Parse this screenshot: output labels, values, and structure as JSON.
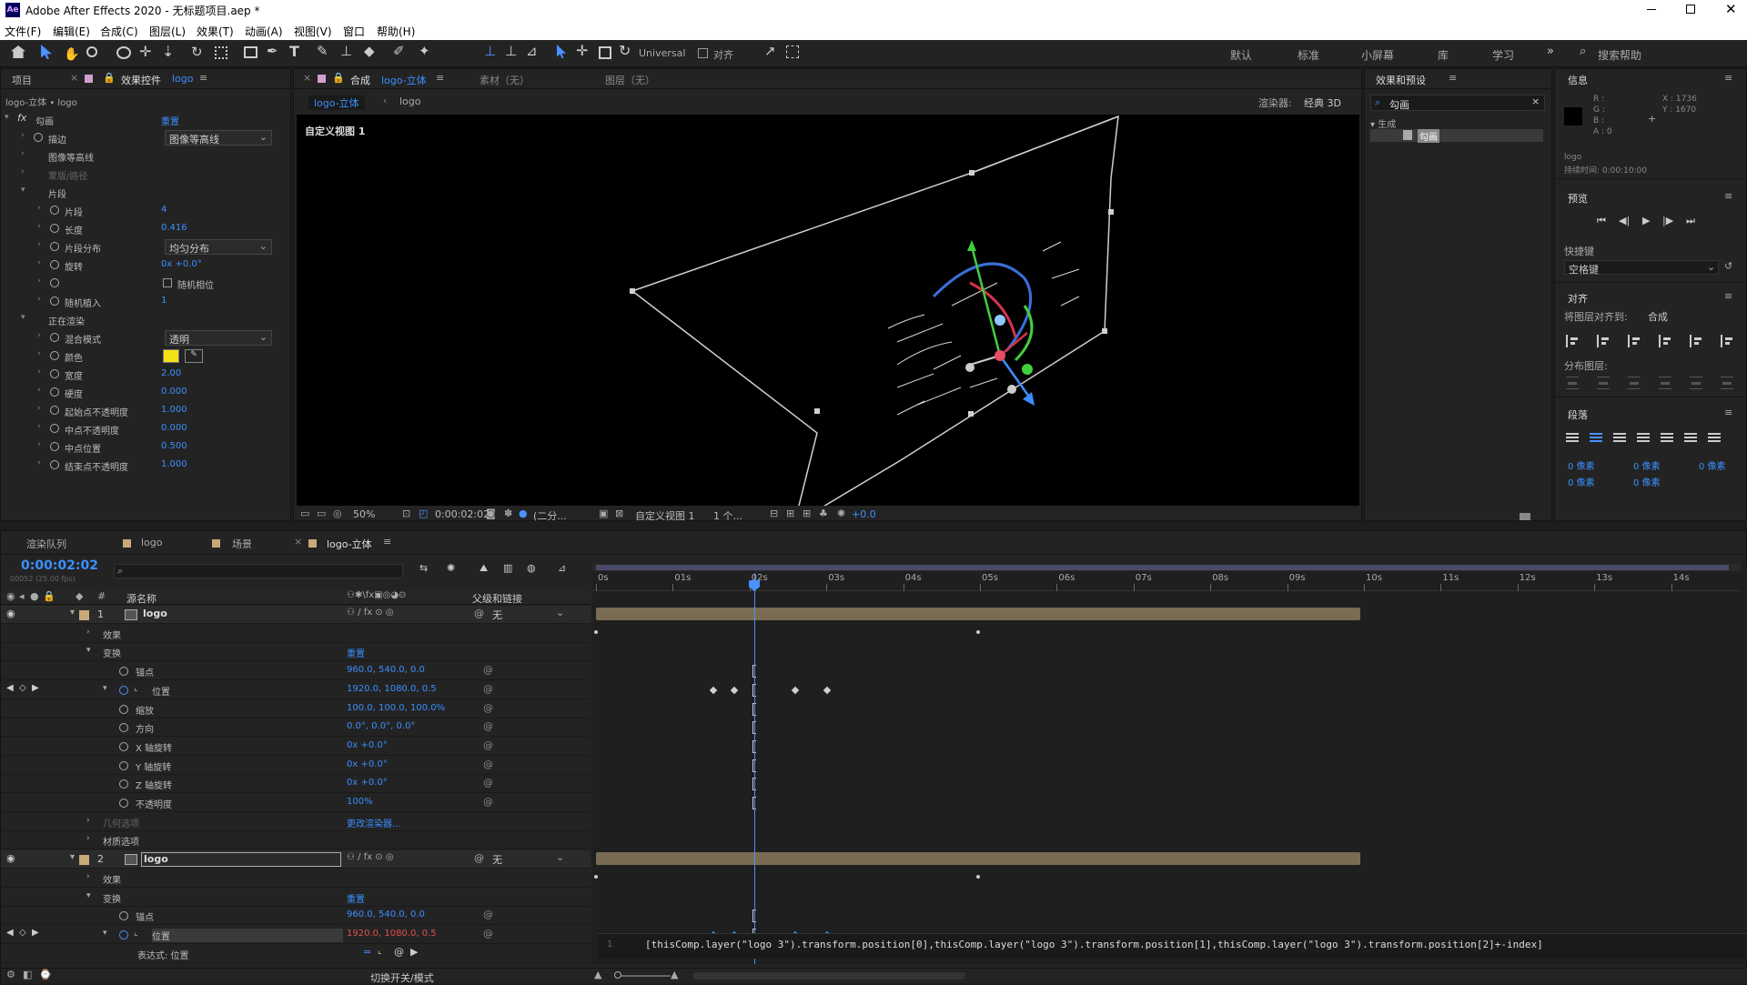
{
  "app": {
    "title": "Adobe After Effects 2020 - 无标题项目.aep *",
    "logo": "Ae"
  },
  "menu": [
    "文件(F)",
    "编辑(E)",
    "合成(C)",
    "图层(L)",
    "效果(T)",
    "动画(A)",
    "视图(V)",
    "窗口",
    "帮助(H)"
  ],
  "toolbar": {
    "universal": "Universal",
    "align": "对齐",
    "workspaces": [
      "默认",
      "标准",
      "小屏幕",
      "库",
      "学习"
    ],
    "search": "搜索帮助"
  },
  "left_panel": {
    "tab_project": "项目",
    "tab_effects": "效果控件",
    "tab_layer": "logo",
    "breadcrumb": "logo-立体 • logo",
    "rows": [
      {
        "label": "勾画",
        "value": "重置",
        "indent": 0,
        "fx": true
      },
      {
        "label": "描边",
        "value": "图像等高线",
        "indent": 1,
        "dropdown": true
      },
      {
        "label": "图像等高线",
        "value": "",
        "indent": 1
      },
      {
        "label": "蒙版/路径",
        "value": "",
        "indent": 1,
        "dim": true
      },
      {
        "label": "片段",
        "value": "",
        "indent": 1,
        "open": true
      },
      {
        "label": "片段",
        "value": "4",
        "indent": 2
      },
      {
        "label": "长度",
        "value": "0.416",
        "indent": 2,
        "active": true
      },
      {
        "label": "片段分布",
        "value": "均匀分布",
        "indent": 2,
        "dropdown": true
      },
      {
        "label": "旋转",
        "value": "0x +0.0°",
        "indent": 2
      },
      {
        "label": "",
        "value": "随机相位",
        "indent": 2,
        "check": true
      },
      {
        "label": "随机植入",
        "value": "1",
        "indent": 2
      },
      {
        "label": "正在渲染",
        "value": "",
        "indent": 1,
        "open": true
      },
      {
        "label": "混合模式",
        "value": "透明",
        "indent": 2,
        "dropdown": true
      },
      {
        "label": "颜色",
        "value": "",
        "indent": 2,
        "color": "#f4e314"
      },
      {
        "label": "宽度",
        "value": "2.00",
        "indent": 2
      },
      {
        "label": "硬度",
        "value": "0.000",
        "indent": 2
      },
      {
        "label": "起始点不透明度",
        "value": "1.000",
        "indent": 2
      },
      {
        "label": "中点不透明度",
        "value": "0.000",
        "indent": 2
      },
      {
        "label": "中点位置",
        "value": "0.500",
        "indent": 2
      },
      {
        "label": "结束点不透明度",
        "value": "1.000",
        "indent": 2
      }
    ]
  },
  "comp_panel": {
    "tab_comp": "合成",
    "tab_comp_name": "logo-立体",
    "tab_footage": "素材（无）",
    "tab_layer": "图层（无）",
    "sub_tab1": "logo-立体",
    "sub_tab2": "logo",
    "renderer_label": "渲染器:",
    "renderer": "经典 3D",
    "view_label": "自定义视图 1",
    "footer": {
      "zoom": "50%",
      "time": "0:00:02:02",
      "res": "(二分...",
      "view": "自定义视图 1",
      "views": "1 个...",
      "exposure": "+0.0"
    }
  },
  "effects_panel": {
    "title": "效果和预设",
    "search": "勾画",
    "category": "生成",
    "item": "勾画"
  },
  "info_panel": {
    "title": "信息",
    "r": "R :",
    "g": "G :",
    "b": "B :",
    "a": "A : 0",
    "x": "X : 1736",
    "y": "Y : 1670",
    "layer": "logo",
    "duration": "持续时间: 0:00:10:00"
  },
  "preview_panel": {
    "title": "预览"
  },
  "shortcut": {
    "label": "快捷键",
    "value": "空格键"
  },
  "align_panel": {
    "title": "对齐",
    "align_to_label": "将图层对齐到:",
    "align_to": "合成",
    "distribute": "分布图层:"
  },
  "paragraph_panel": {
    "title": "段落",
    "px": [
      "0 像素",
      "0 像素",
      "0 像素",
      "0 像素",
      "0 像素"
    ]
  },
  "timeline": {
    "tabs": [
      "渲染队列",
      "logo",
      "场景",
      "logo-立体"
    ],
    "timecode": "0:00:02:02",
    "frames": "00052 (25.00 fps)",
    "col_name": "源名称",
    "col_parent": "父级和链接",
    "ruler": [
      "0s",
      "01s",
      "02s",
      "03s",
      "04s",
      "05s",
      "06s",
      "07s",
      "08s",
      "09s",
      "10s",
      "11s",
      "12s",
      "13s",
      "14s"
    ],
    "rows": [
      {
        "num": "1",
        "name": "logo",
        "type": "layer",
        "parent": "无"
      },
      {
        "name": "效果",
        "type": "group",
        "indent": 1
      },
      {
        "name": "变换",
        "type": "group",
        "indent": 1,
        "open": true,
        "value": "重置"
      },
      {
        "name": "锚点",
        "type": "prop",
        "value": "960.0, 540.0, 0.0"
      },
      {
        "name": "位置",
        "type": "prop",
        "value": "1920.0, 1080.0, 0.5",
        "graph": true,
        "nav": true
      },
      {
        "name": "缩放",
        "type": "prop",
        "value": "100.0, 100.0, 100.0%"
      },
      {
        "name": "方向",
        "type": "prop",
        "value": "0.0°, 0.0°, 0.0°"
      },
      {
        "name": "X 轴旋转",
        "type": "prop",
        "value": "0x +0.0°"
      },
      {
        "name": "Y 轴旋转",
        "type": "prop",
        "value": "0x +0.0°"
      },
      {
        "name": "Z 轴旋转",
        "type": "prop",
        "value": "0x +0.0°"
      },
      {
        "name": "不透明度",
        "type": "prop",
        "value": "100%"
      },
      {
        "name": "几何选项",
        "type": "group",
        "indent": 1,
        "dim": true,
        "value": "更改渲染器..."
      },
      {
        "name": "材质选项",
        "type": "group",
        "indent": 1
      },
      {
        "num": "2",
        "name": "logo",
        "type": "layer",
        "parent": "无",
        "selected": true
      },
      {
        "name": "效果",
        "type": "group",
        "indent": 1
      },
      {
        "name": "变换",
        "type": "group",
        "indent": 1,
        "open": true,
        "value": "重置"
      },
      {
        "name": "锚点",
        "type": "prop",
        "value": "960.0, 540.0, 0.0"
      },
      {
        "name": "位置",
        "type": "prop",
        "value": "1920.0, 1080.0, 0.5",
        "graph": true,
        "nav": true,
        "red": true,
        "highlight": true
      },
      {
        "name": "表达式: 位置",
        "type": "expr"
      }
    ],
    "expression": "[thisComp.layer(\"logo 3\").transform.position[0],thisComp.layer(\"logo 3\").transform.position[1],thisComp.layer(\"logo 3\").transform.position[2]+-index]",
    "expr_line": "1",
    "footer": "切换开关/模式"
  }
}
